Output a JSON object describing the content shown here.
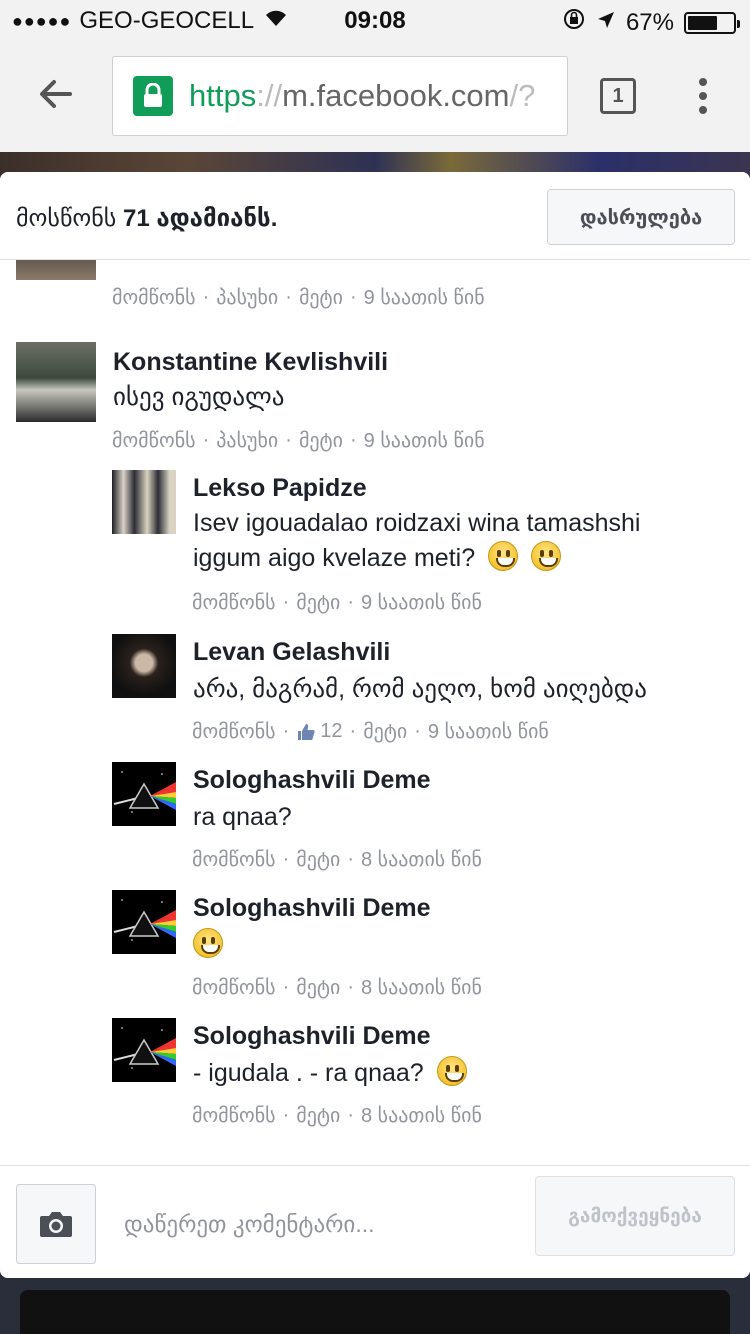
{
  "status_bar": {
    "signal": "●●●●●",
    "carrier": "GEO-GEOCELL",
    "time": "09:08",
    "battery_percent": "67%",
    "battery_level": 0.67
  },
  "browser": {
    "url_scheme": "https",
    "url_sep": "://",
    "url_host": "m.facebook.com",
    "url_rest": "/?",
    "tab_count": "1",
    "secure_color": "#0f9d58"
  },
  "modal": {
    "likes_prefix": "მოსწონს",
    "likes_count": "71",
    "likes_suffix": "ადამიანს.",
    "done_label": "დასრულება"
  },
  "actions": {
    "like": "მომწონს",
    "reply": "პასუხი",
    "more": "მეტი",
    "sep": "·"
  },
  "comments": [
    {
      "time": "9 საათის წინ"
    },
    {
      "name": "Konstantine Kevlishvili",
      "text": "ისევ იგუდალა",
      "time": "9 საათის წინ"
    },
    {
      "name": "Lekso Papidze",
      "text_line1": "Isev igouadalao roidzaxi wina tamashshi",
      "text_line2": "iggum aigo kvelaze meti?",
      "time": "9 საათის წინ"
    },
    {
      "name": "Levan Gelashvili",
      "text": "არა, მაგრამ, რომ აეღო, ხომ აიღებდა",
      "like_count": "12",
      "time": "9 საათის წინ"
    },
    {
      "name": "Sologhashvili Deme",
      "text": "ra qnaa?",
      "time": "8 საათის წინ"
    },
    {
      "name": "Sologhashvili Deme",
      "text": "",
      "time": "8 საათის წინ"
    },
    {
      "name": "Sologhashvili Deme",
      "text": "- igudala . - ra qnaa?",
      "time": "8 საათის წინ"
    }
  ],
  "composer": {
    "placeholder": "დაწერეთ კომენტარი...",
    "post_label": "გამოქვეყნება"
  }
}
